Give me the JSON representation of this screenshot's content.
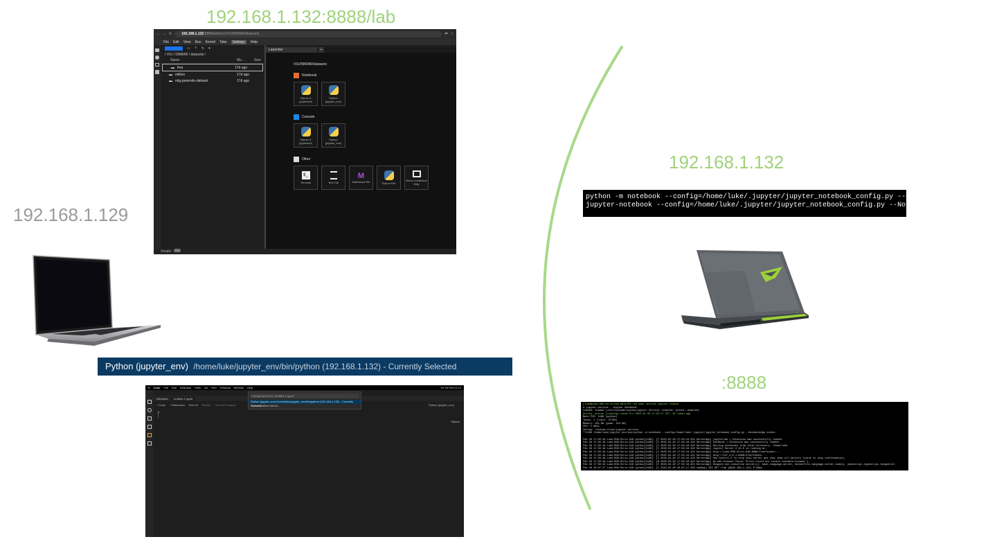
{
  "labels": {
    "lab_url_label": "192.168.1.132:8888/lab",
    "client_ip": "192.168.1.129",
    "server_ip": "192.168.1.132",
    "port": ":8888"
  },
  "colors": {
    "green_label": "#9fd27a",
    "gray_label": "#9a9a9a",
    "arc": "#a8d98a",
    "kernel_bar": "#0b3a63"
  },
  "jupyter_lab": {
    "url_host": "192.168.1.132",
    "url_rest": ":8888/lab/tree/VIU/09MIAR/datasets",
    "menu": [
      "File",
      "Edit",
      "View",
      "Run",
      "Kernel",
      "Tabs",
      "Settings",
      "Help"
    ],
    "breadcrumb": "/ VIU / 09MIAR / datasets /",
    "columns": {
      "name": "Name",
      "modified": "Mo...",
      "size": "Size"
    },
    "files": [
      {
        "name": "fma",
        "modified": "17d ago"
      },
      {
        "name": "million",
        "modified": "17d ago"
      },
      {
        "name": "mtg-jamendo-dataset",
        "modified": "17d ago"
      }
    ],
    "tab": "Launcher",
    "launcher_path": "VIU/09MIAR/datasets",
    "sections": {
      "notebook": "Notebook",
      "console": "Console",
      "other": "Other"
    },
    "notebook_cards": [
      {
        "l1": "Python 3",
        "l2": "(ipykernel)"
      },
      {
        "l1": "Python",
        "l2": "(jupyter_env)"
      }
    ],
    "console_cards": [
      {
        "l1": "Python 3",
        "l2": "(ipykernel)"
      },
      {
        "l1": "Python",
        "l2": "(jupyter_env)"
      }
    ],
    "other_cards": [
      "Terminal",
      "Text File",
      "Markdown File",
      "Python File",
      "Show Contextual Help"
    ],
    "status": "Simple"
  },
  "kernel_bar": {
    "name": "Python (jupyter_env)",
    "path": "/home/luke/jupyter_env/bin/python (192.168.1.132) - Currently Selected"
  },
  "vscode": {
    "menu": [
      "Code",
      "File",
      "Edit",
      "Selection",
      "View",
      "Go",
      "Run",
      "Terminal",
      "Window",
      "Help"
    ],
    "clock": "Fri 28 Feb 21:12",
    "tabs": [
      "Welcome",
      "Untitled-1.ipynb"
    ],
    "toolbar": [
      "+ Code",
      "+ Markdown",
      "Run All",
      "Restart",
      "Clear All Outputs"
    ],
    "kernel_label": "Python (jupyter_env)",
    "picker_placeholder": "Change kernel for 'Untitled-1.ipynb'",
    "picker_items": [
      "Python (jupyter_env) /home/luke/jupyter_env/bin/python (192.168.1.132) - Currently Selected",
      "Select Another Kernel..."
    ],
    "cell_lang": "Python"
  },
  "commands": {
    "line1": "python -m notebook --config=/home/luke/.jupyter/jupyter_notebook_config.py --NotebookApp.token",
    "line2": "jupyter-notebook --config=/home/luke/.jupyter/jupyter_notebook_config.py --NotebookApp.token='"
  },
  "terminal": {
    "prompt": "[luke@Luke-ROG-Strix-G16-G614JIR ~]$ sudo service jupyter status",
    "lines": [
      "● jupyter.service - Jupyter Notebook",
      "     Loaded: loaded (/etc/systemd/system/jupyter.service; enabled; preset: enabled)",
      "     Active: active (running) since Fri 2025-02-28 17:02:17 CET; 3h 11min ago",
      "   Main PID: 1198 (python)",
      "      Tasks: 1 (limit: 37798)",
      "     Memory: 101.9M (peak: 210.9M)",
      "        CPU: 1.804s",
      "     CGroup: /system.slice/jupyter.service",
      "             └─1198 /home/luke/jupyter_env/bin/python -m notebook --config=/home/luke/.jupyter/jupyter_notebook_config.py --NotebookApp.token=",
      "",
      "Feb 28 17:02:18 Luke-ROG-Strix-G16 python[1198]: [I 2025-02-28 17:02:18.432 ServerApp] jupyterlab | extension was successfully loaded.",
      "Feb 28 17:02:18 Luke-ROG-Strix-G16 python[1198]: [I 2025-02-28 17:02:18.432 ServerApp] notebook | extension was successfully loaded.",
      "Feb 28 17:02:18 Luke-ROG-Strix-G16 python[1198]: [I 2025-02-28 17:02:18.432 ServerApp] Serving notebooks from local directory: /home/luke",
      "Feb 28 17:02:18 Luke-ROG-Strix-G16 python[1198]: [I 2025-02-28 17:02:18.432 ServerApp] Jupyter Server 2.15.0 is running at:",
      "Feb 28 17:02:18 Luke-ROG-Strix-G16 python[1198]: [I 2025-02-28 17:02:18.432 ServerApp] http://Luke-ROG-Strix-G16:8888/tree?token=...",
      "Feb 28 17:02:18 Luke-ROG-Strix-G16 python[1198]: [I 2025-02-28 17:02:18.432 ServerApp]     http://127.0.0.1:8888/tree?token=...",
      "Feb 28 17:02:18 Luke-ROG-Strix-G16 python[1198]: [I 2025-02-28 17:02:18.433 ServerApp] Use Control-C to stop this server and shut down all kernels (twice to skip confirmation).",
      "Feb 28 17:02:18 Luke-ROG-Strix-G16 python[1198]: [W 2025-02-28 17:02:18.441 ServerApp] No web browser found: Error('could not locate runnable browser').",
      "Feb 28 17:02:18 Luke-ROG-Strix-G16 python[1198]: [I 2025-02-28 17:02:18.453 ServerApp] Skipped non-installed server(s): bash-language-server, dockerfile-language-server-nodejs, javascript-typescript-langserver",
      "Feb 28 20:07:17 Luke-ROG-Strix-G16 python[1198]: [I 2025-02-28 20:07:17.468 LabApp] 302 GET /lab (@192.168.1.121) 0.58ms"
    ]
  }
}
